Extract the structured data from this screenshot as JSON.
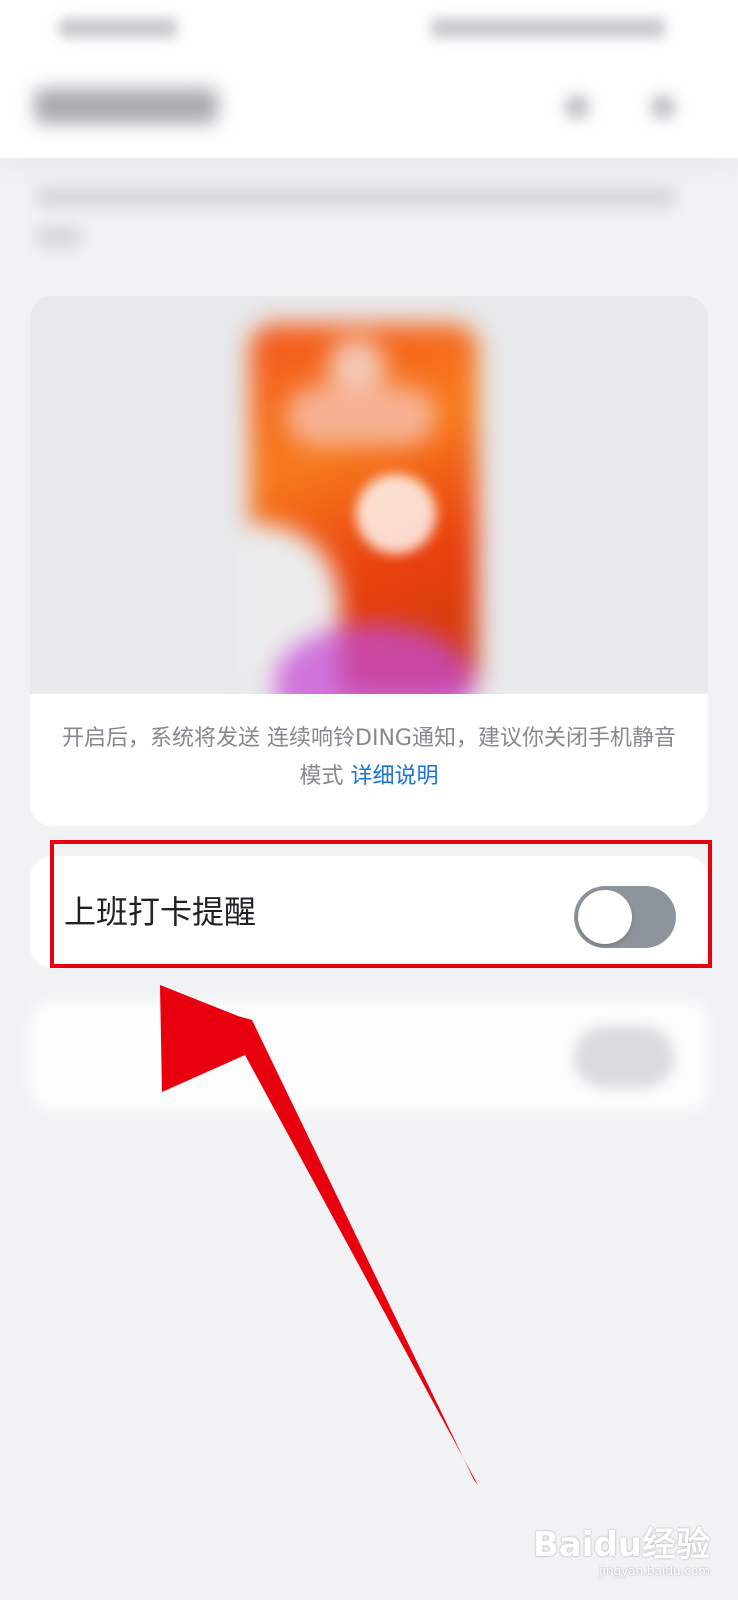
{
  "preview": {
    "description_prefix": "开启后，系统将发送 连续响铃DING通知，建议你关闭手机静音模式 ",
    "details_link": "详细说明"
  },
  "settings": {
    "clock_in_reminder": {
      "label": "上班打卡提醒",
      "enabled": false
    }
  },
  "watermark": {
    "logo_text": "Baidu经验",
    "url": "jingyan.baidu.com"
  },
  "colors": {
    "highlight": "#e60012",
    "link": "#1a73d6",
    "toggle_off": "#8e949c"
  }
}
